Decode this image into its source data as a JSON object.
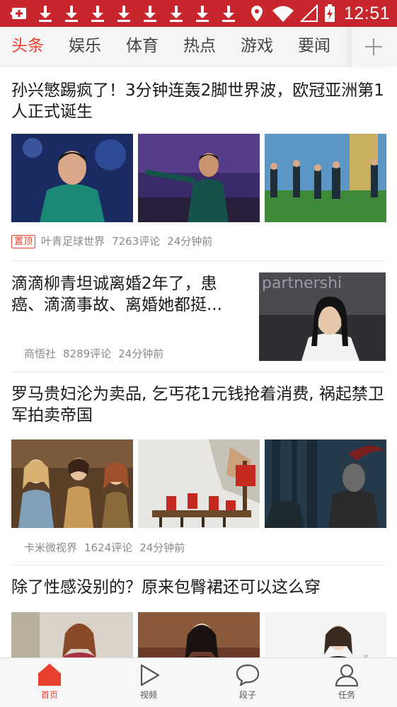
{
  "status_bar": {
    "time": "12:51",
    "left_icons": [
      "notification-plus-icon",
      "download-icon",
      "download-icon",
      "download-icon",
      "download-icon",
      "download-icon",
      "download-icon",
      "download-icon",
      "download-icon"
    ],
    "right_icons": [
      "location-icon",
      "wifi-icon",
      "signal-icon",
      "battery-charging-icon"
    ]
  },
  "tabs": [
    {
      "label": "头条",
      "active": true
    },
    {
      "label": "娱乐",
      "active": false
    },
    {
      "label": "体育",
      "active": false
    },
    {
      "label": "热点",
      "active": false
    },
    {
      "label": "游戏",
      "active": false
    },
    {
      "label": "要闻",
      "active": false
    }
  ],
  "add_tab_icon": "plus-icon",
  "articles": [
    {
      "title": "孙兴慜踢疯了！3分钟连轰2脚世界波，欧冠亚洲第1人正式诞生",
      "badge": "置顶",
      "source": "叶青足球世界",
      "comments": "7263评论",
      "time": "24分钟前"
    },
    {
      "title": "滴滴柳青坦诚离婚2年了，患癌、滴滴事故、离婚她都挺...",
      "source": "商悟社",
      "comments": "8289评论",
      "time": "24分钟前"
    },
    {
      "title": "罗马贵妇沦为卖品, 乞丐花1元钱抢着消费, 祸起禁卫军拍卖帝国",
      "source": "卡米微视界",
      "comments": "1624评论",
      "time": "24分钟前"
    },
    {
      "title": "除了性感没别的？原来包臀裙还可以这么穿"
    }
  ],
  "bottom_nav": [
    {
      "label": "首页",
      "icon": "home-icon",
      "active": true
    },
    {
      "label": "视频",
      "icon": "play-icon",
      "active": false
    },
    {
      "label": "段子",
      "icon": "chat-bubble-icon",
      "active": false
    },
    {
      "label": "任务",
      "icon": "person-icon",
      "active": false
    }
  ],
  "colors": {
    "status_bar": "#c7262d",
    "accent": "#e8402f",
    "meta_text": "#8a8a8a"
  }
}
